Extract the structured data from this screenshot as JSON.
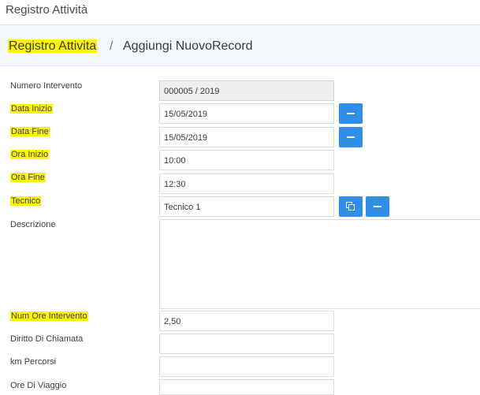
{
  "app": {
    "title": "Registro Attività"
  },
  "breadcrumb": {
    "module": "Registro Attivita",
    "separator": "/",
    "page": "Aggiungi NuovoRecord"
  },
  "form": {
    "numero_intervento": {
      "label": "Numero Intervento",
      "value": "000005 / 2019"
    },
    "data_inizio": {
      "label": "Data Inizio",
      "value": "15/05/2019"
    },
    "data_fine": {
      "label": "Data Fine",
      "value": "15/05/2019"
    },
    "ora_inizio": {
      "label": "Ora Inizio",
      "value": "10:00"
    },
    "ora_fine": {
      "label": "Ora Fine",
      "value": "12:30"
    },
    "tecnico": {
      "label": "Tecnico",
      "value": "Tecnico 1"
    },
    "descrizione": {
      "label": "Descrizione",
      "value": ""
    },
    "num_ore": {
      "label": "Num Ore Intervento",
      "value": "2,50"
    },
    "diritto_chiamata": {
      "label": "Diritto Di Chiamata",
      "value": ""
    },
    "km_percorsi": {
      "label": "km Percorsi",
      "value": ""
    },
    "ore_viaggio": {
      "label": "Ore Di Viaggio",
      "value": ""
    }
  },
  "colors": {
    "accent": "#2f8ee6",
    "highlight": "#fbf500"
  },
  "icons": {
    "clear": "minus-icon",
    "select": "copy-icon"
  }
}
